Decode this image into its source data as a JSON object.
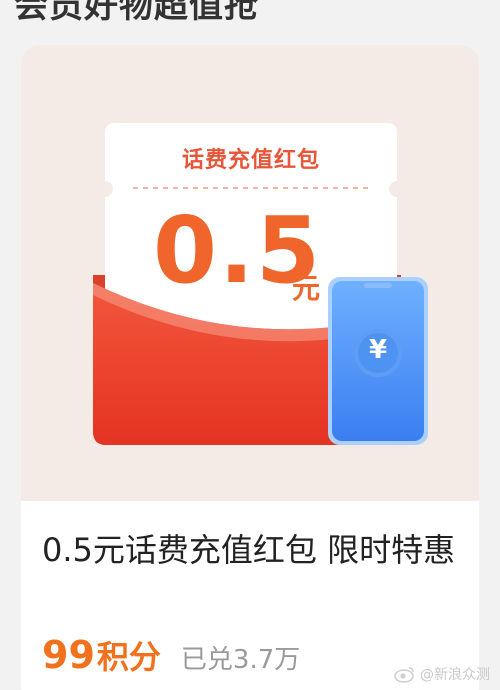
{
  "header": {
    "cut_text": "会员好物超值抢"
  },
  "product": {
    "coupon_label": "话费充值红包",
    "coupon_amount": "0.5",
    "coupon_unit": "元",
    "yen_symbol": "¥",
    "title": "0.5元话费充值红包 限时特惠",
    "price_value": "99",
    "price_unit": "积分",
    "redeemed": "已兑3.7万"
  },
  "watermark": {
    "text": "@新浪众测"
  },
  "colors": {
    "accent_orange": "#f2711c",
    "coupon_red": "#e8563a",
    "phone_blue": "#3f8ff2",
    "card_bg": "#f5ebe6"
  }
}
